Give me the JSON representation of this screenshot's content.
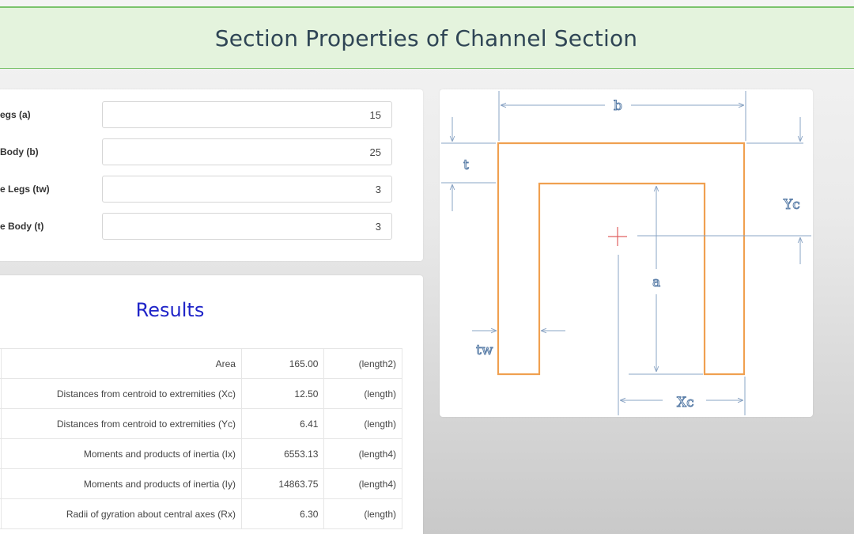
{
  "header": {
    "title": "Section Properties of Channel Section"
  },
  "inputs": [
    {
      "label": "egs (a)",
      "value": "15"
    },
    {
      "label": "Body (b)",
      "value": "25"
    },
    {
      "label": "e Legs (tw)",
      "value": "3"
    },
    {
      "label": "e Body (t)",
      "value": "3"
    }
  ],
  "results": {
    "title": "Results",
    "rows": [
      {
        "name": "Area",
        "value": "165.00",
        "unit": "(length2)"
      },
      {
        "name": "Distances from centroid to extremities (Xc)",
        "value": "12.50",
        "unit": "(length)"
      },
      {
        "name": "Distances from centroid to extremities (Yc)",
        "value": "6.41",
        "unit": "(length)"
      },
      {
        "name": "Moments and products of inertia (Ix)",
        "value": "6553.13",
        "unit": "(length4)"
      },
      {
        "name": "Moments and products of inertia (Iy)",
        "value": "14863.75",
        "unit": "(length4)"
      },
      {
        "name": "Radii of gyration about central axes (Rx)",
        "value": "6.30",
        "unit": "(length)"
      }
    ]
  },
  "diagram": {
    "labels": {
      "b": "b",
      "t": "t",
      "yc": "Yc",
      "a": "a",
      "tw": "tw",
      "xc": "Xc"
    },
    "colors": {
      "section_outline": "#f0a050",
      "dimension_lines": "#8aa4c4",
      "centroid_marker": "#e06060"
    }
  }
}
